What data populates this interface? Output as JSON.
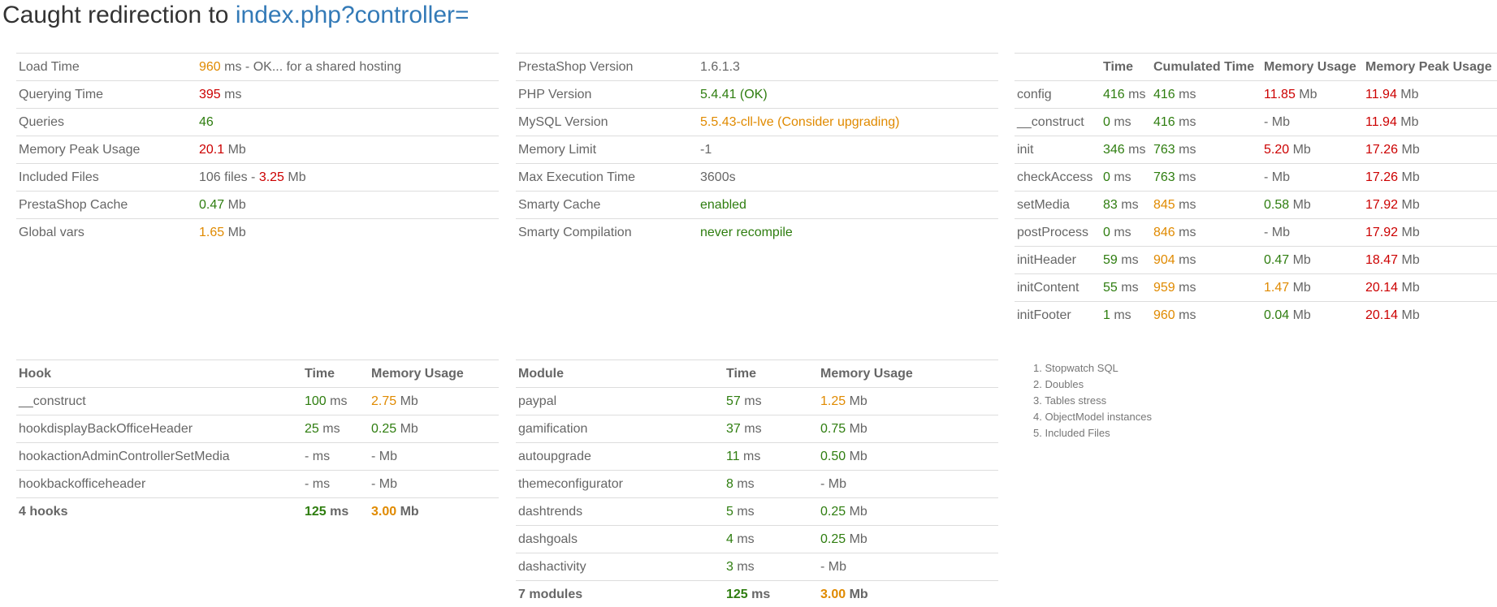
{
  "header": {
    "title_text": "Caught redirection to",
    "link_text": "index.php?controller="
  },
  "load_stats": {
    "rows": [
      {
        "label": "Load Time",
        "value": "960",
        "unit": "ms - OK... for a shared hosting",
        "color": "o"
      },
      {
        "label": "Querying Time",
        "value": "395",
        "unit": "ms",
        "color": "r"
      },
      {
        "label": "Queries",
        "value": "46",
        "unit": "",
        "color": "g"
      },
      {
        "label": "Memory Peak Usage",
        "value": "20.1",
        "unit": "Mb",
        "color": "r"
      },
      {
        "label": "Included Files",
        "prefix": "106 files - ",
        "value": "3.25",
        "unit": "Mb",
        "color": "r"
      },
      {
        "label": "PrestaShop Cache",
        "value": "0.47",
        "unit": "Mb",
        "color": "g"
      },
      {
        "label": "Global vars",
        "value": "1.65",
        "unit": "Mb",
        "color": "o"
      }
    ]
  },
  "environment": {
    "rows": [
      {
        "label": "PrestaShop Version",
        "value": "1.6.1.3",
        "color": ""
      },
      {
        "label": "PHP Version",
        "value": "5.4.41 (OK)",
        "color": "g"
      },
      {
        "label": "MySQL Version",
        "value": "5.5.43-cll-lve (Consider upgrading)",
        "color": "o"
      },
      {
        "label": "Memory Limit",
        "value": "-1",
        "color": ""
      },
      {
        "label": "Max Execution Time",
        "value": "3600s",
        "color": ""
      },
      {
        "label": "Smarty Cache",
        "value": "enabled",
        "color": "g"
      },
      {
        "label": "Smarty Compilation",
        "value": "never recompile",
        "color": "g"
      }
    ]
  },
  "steps": {
    "headers": [
      "",
      "Time",
      "Cumulated Time",
      "Memory Usage",
      "Memory Peak Usage"
    ],
    "rows": [
      {
        "name": "config",
        "time": "416",
        "time_c": "g",
        "cum": "416",
        "cum_c": "g",
        "mem": "11.85",
        "mem_c": "r",
        "peak": "11.94",
        "peak_c": "r"
      },
      {
        "name": "__construct",
        "time": "0",
        "time_c": "g",
        "cum": "416",
        "cum_c": "g",
        "mem": "-",
        "mem_c": "",
        "peak": "11.94",
        "peak_c": "r"
      },
      {
        "name": "init",
        "time": "346",
        "time_c": "g",
        "cum": "763",
        "cum_c": "g",
        "mem": "5.20",
        "mem_c": "r",
        "peak": "17.26",
        "peak_c": "r"
      },
      {
        "name": "checkAccess",
        "time": "0",
        "time_c": "g",
        "cum": "763",
        "cum_c": "g",
        "mem": "-",
        "mem_c": "",
        "peak": "17.26",
        "peak_c": "r"
      },
      {
        "name": "setMedia",
        "time": "83",
        "time_c": "g",
        "cum": "845",
        "cum_c": "o",
        "mem": "0.58",
        "mem_c": "g",
        "peak": "17.92",
        "peak_c": "r"
      },
      {
        "name": "postProcess",
        "time": "0",
        "time_c": "g",
        "cum": "846",
        "cum_c": "o",
        "mem": "-",
        "mem_c": "",
        "peak": "17.92",
        "peak_c": "r"
      },
      {
        "name": "initHeader",
        "time": "59",
        "time_c": "g",
        "cum": "904",
        "cum_c": "o",
        "mem": "0.47",
        "mem_c": "g",
        "peak": "18.47",
        "peak_c": "r"
      },
      {
        "name": "initContent",
        "time": "55",
        "time_c": "g",
        "cum": "959",
        "cum_c": "o",
        "mem": "1.47",
        "mem_c": "o",
        "peak": "20.14",
        "peak_c": "r"
      },
      {
        "name": "initFooter",
        "time": "1",
        "time_c": "g",
        "cum": "960",
        "cum_c": "o",
        "mem": "0.04",
        "mem_c": "g",
        "peak": "20.14",
        "peak_c": "r"
      }
    ],
    "ms": "ms",
    "mb": "Mb"
  },
  "hooks": {
    "headers": [
      "Hook",
      "Time",
      "Memory Usage"
    ],
    "rows": [
      {
        "name": "__construct",
        "time": "100",
        "time_c": "g",
        "mem": "2.75",
        "mem_c": "o"
      },
      {
        "name": "hookdisplayBackOfficeHeader",
        "time": "25",
        "time_c": "g",
        "mem": "0.25",
        "mem_c": "g"
      },
      {
        "name": "hookactionAdminControllerSetMedia",
        "time": "-",
        "time_c": "",
        "mem": "-",
        "mem_c": ""
      },
      {
        "name": "hookbackofficeheader",
        "time": "-",
        "time_c": "",
        "mem": "-",
        "mem_c": ""
      }
    ],
    "summary": {
      "name": "4 hooks",
      "time": "125",
      "time_c": "g",
      "mem": "3.00",
      "mem_c": "o"
    }
  },
  "modules": {
    "headers": [
      "Module",
      "Time",
      "Memory Usage"
    ],
    "rows": [
      {
        "name": "paypal",
        "time": "57",
        "time_c": "g",
        "mem": "1.25",
        "mem_c": "o"
      },
      {
        "name": "gamification",
        "time": "37",
        "time_c": "g",
        "mem": "0.75",
        "mem_c": "g"
      },
      {
        "name": "autoupgrade",
        "time": "11",
        "time_c": "g",
        "mem": "0.50",
        "mem_c": "g"
      },
      {
        "name": "themeconfigurator",
        "time": "8",
        "time_c": "g",
        "mem": "-",
        "mem_c": ""
      },
      {
        "name": "dashtrends",
        "time": "5",
        "time_c": "g",
        "mem": "0.25",
        "mem_c": "g"
      },
      {
        "name": "dashgoals",
        "time": "4",
        "time_c": "g",
        "mem": "0.25",
        "mem_c": "g"
      },
      {
        "name": "dashactivity",
        "time": "3",
        "time_c": "g",
        "mem": "-",
        "mem_c": ""
      }
    ],
    "summary": {
      "name": "7 modules",
      "time": "125",
      "time_c": "g",
      "mem": "3.00",
      "mem_c": "o"
    }
  },
  "debug_links": [
    "Stopwatch SQL",
    "Doubles",
    "Tables stress",
    "ObjectModel instances",
    "Included Files"
  ],
  "ms": "ms",
  "mb": "Mb"
}
